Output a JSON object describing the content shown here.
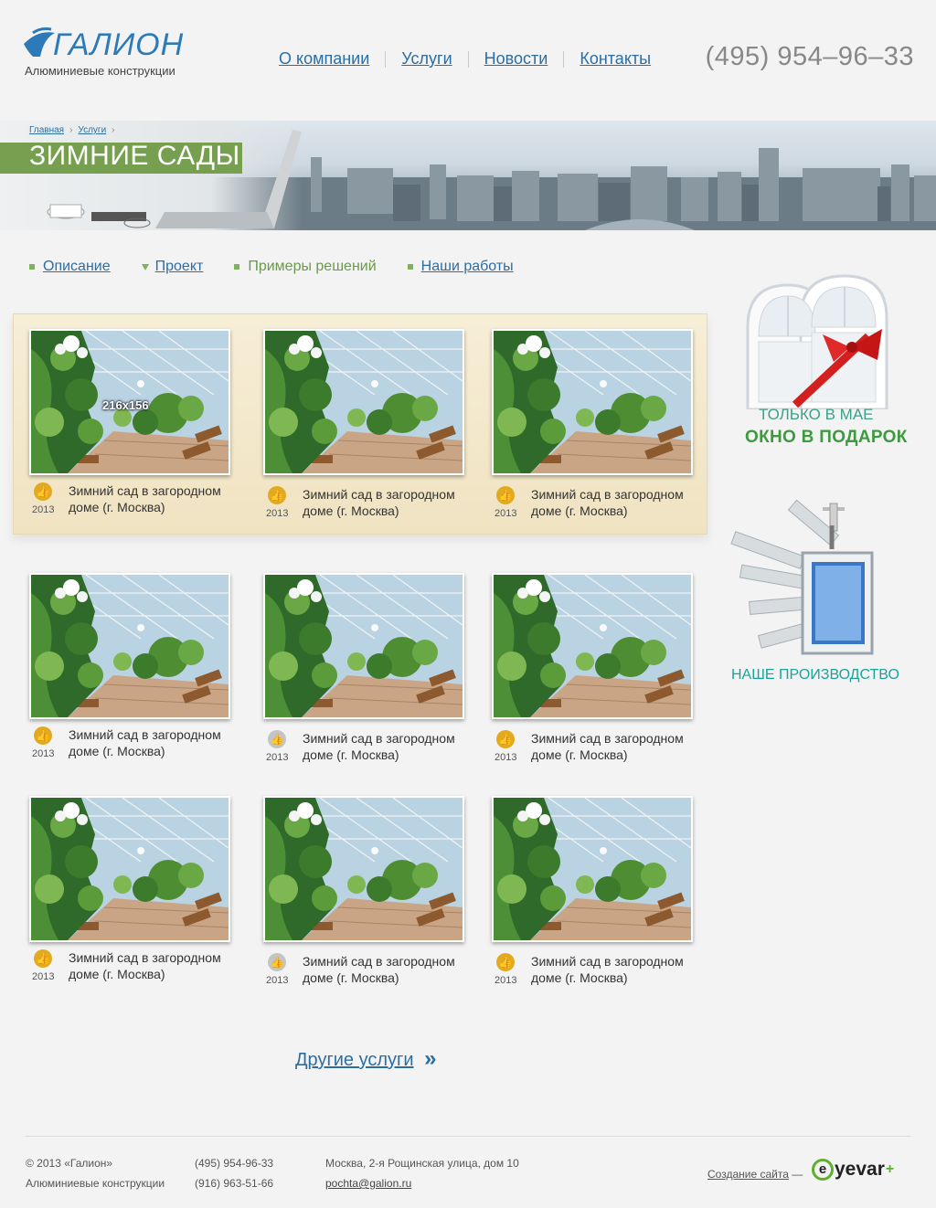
{
  "header": {
    "logo_text": "ГАЛИОН",
    "logo_subtitle": "Алюминиевые конструкции",
    "nav": [
      "О компании",
      "Услуги",
      "Новости",
      "Контакты"
    ],
    "phone": "(495) 954–96–33"
  },
  "banner": {
    "breadcrumb": [
      "Главная",
      "Услуги"
    ],
    "title": "ЗИМНИЕ САДЫ"
  },
  "subnav": {
    "items": [
      {
        "label": "Описание",
        "marker": "bullet",
        "link": true
      },
      {
        "label": "Проект",
        "marker": "triangle",
        "link": true
      },
      {
        "label": "Примеры решений",
        "marker": "bullet",
        "link": false
      },
      {
        "label": "Наши работы",
        "marker": "bullet",
        "link": true
      }
    ]
  },
  "gallery": {
    "placeholder_size": "216x156",
    "items": [
      {
        "title": "Зимний сад в загородном доме (г. Москва)",
        "year": "2013",
        "icon": "thumbs-up-icon"
      },
      {
        "title": "Зимний сад в загородном доме (г. Москва)",
        "year": "2013",
        "icon": "thumbs-up-icon"
      },
      {
        "title": "Зимний сад в загородном доме (г. Москва)",
        "year": "2013",
        "icon": "thumbs-up-icon"
      },
      {
        "title": "Зимний сад в загородном доме (г. Москва)",
        "year": "2013",
        "icon": "thumbs-up-icon"
      },
      {
        "title": "Зимний сад в загородном доме (г. Москва)",
        "year": "2013",
        "icon": "thumbs-up-grey-icon"
      },
      {
        "title": "Зимний сад в загородном доме (г. Москва)",
        "year": "2013",
        "icon": "thumbs-up-icon"
      },
      {
        "title": "Зимний сад в загородном доме (г. Москва)",
        "year": "2013",
        "icon": "thumbs-up-icon"
      },
      {
        "title": "Зимний сад в загородном доме (г. Москва)",
        "year": "2013",
        "icon": "thumbs-up-grey-icon"
      },
      {
        "title": "Зимний сад в загородном доме (г. Москва)",
        "year": "2013",
        "icon": "thumbs-up-icon"
      }
    ]
  },
  "promos": {
    "gift_line1": "ТОЛЬКО В МАЕ",
    "gift_line2": "ОКНО В ПОДАРОК",
    "production": "НАШЕ ПРОИЗВОДСТВО"
  },
  "more_link": "Другие услуги",
  "footer": {
    "copyright": "© 2013  «Галион»",
    "subtitle": "Алюминиевые конструкции",
    "phone1": "(495) 954-96-33",
    "phone2": "(916) 963-51-66",
    "address": "Москва, 2-я Рощинская улица, дом 10",
    "email": "pochta@galion.ru",
    "credit_label": "Создание сайта",
    "credit_dash": "—",
    "credit_brand_e": "e",
    "credit_brand": "yevar",
    "credit_plus": "+"
  },
  "colors": {
    "accent_blue": "#2c6ea3",
    "accent_green": "#76a050",
    "promo_teal": "#1aa39a",
    "badge_gold": "#e2aa1e"
  }
}
